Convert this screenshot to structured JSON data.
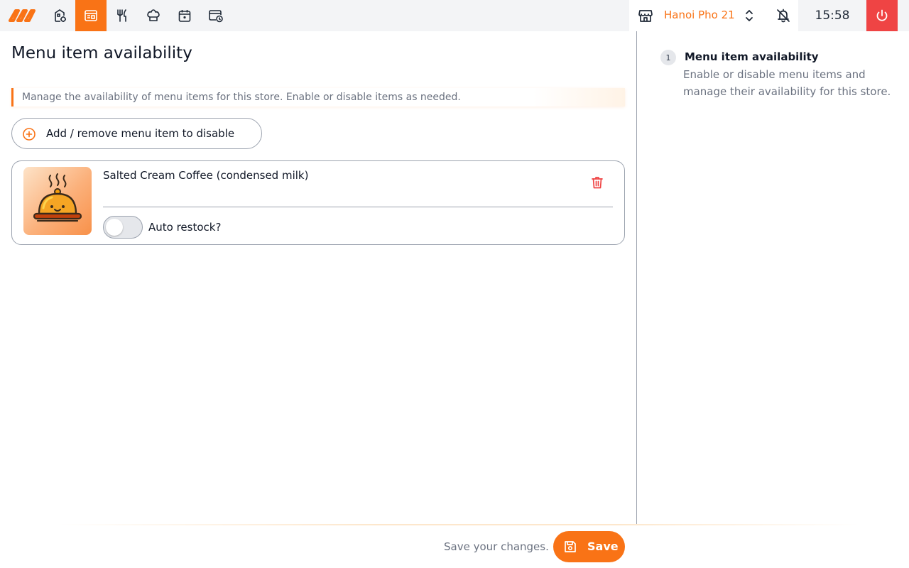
{
  "nav": {
    "items": [
      {
        "icon": "brand-logo-icon",
        "active": false
      },
      {
        "icon": "store-settings-icon",
        "active": false
      },
      {
        "icon": "menu-availability-icon",
        "active": true
      },
      {
        "icon": "fork-knife-icon",
        "active": false
      },
      {
        "icon": "chef-hat-icon",
        "active": false
      },
      {
        "icon": "calendar-icon",
        "active": false
      },
      {
        "icon": "card-clock-icon",
        "active": false
      }
    ]
  },
  "header": {
    "store_name": "Hanoi Pho 21",
    "time": "15:58"
  },
  "page": {
    "title": "Menu item availability",
    "info": "Manage the availability of menu items for this store. Enable or disable items as needed.",
    "add_button_label": "Add / remove menu item to disable"
  },
  "items": [
    {
      "name": "Salted Cream Coffee (condensed milk)",
      "auto_restock_label": "Auto restock?",
      "auto_restock": false
    }
  ],
  "sidebar": {
    "step_number": "1",
    "step_title": "Menu item availability",
    "step_description": "Enable or disable menu items and manage their availability for this store."
  },
  "footer": {
    "hint": "Save your changes.",
    "save_label": "Save"
  },
  "colors": {
    "accent": "#f97316",
    "danger": "#ef4444",
    "muted_text": "#6b7280"
  }
}
